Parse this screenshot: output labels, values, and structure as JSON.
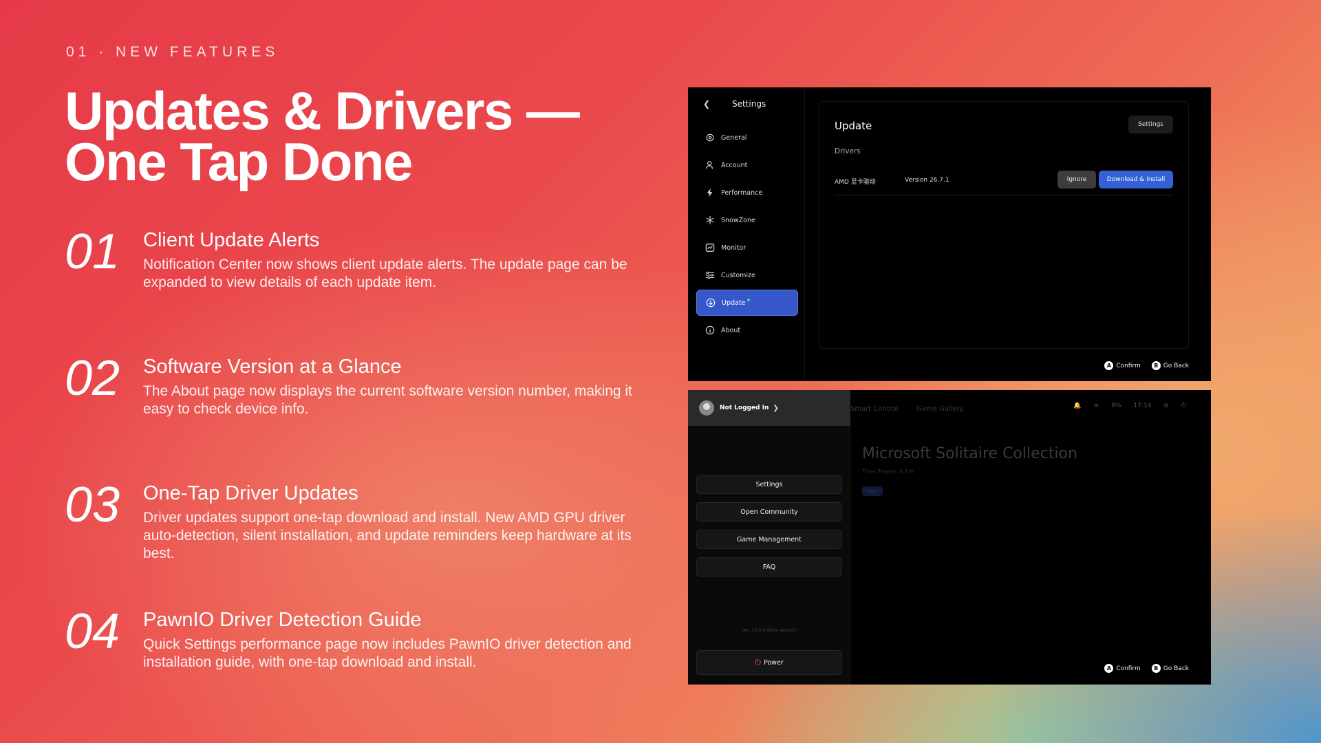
{
  "eyebrow": "01 · NEW FEATURES",
  "title_line1": "Updates & Drivers —",
  "title_line2": "One Tap Done",
  "features": [
    {
      "num": "01",
      "title": "Client Update Alerts",
      "desc": "Notification Center now shows client update alerts. The update page can be expanded to view details of each update item."
    },
    {
      "num": "02",
      "title": "Software Version at a Glance",
      "desc": "The About page now displays the current software version number, making it easy to check device info."
    },
    {
      "num": "03",
      "title": "One-Tap Driver Updates",
      "desc": "Driver updates support one-tap download and install. New AMD GPU driver auto-detection, silent installation, and update reminders keep hardware at its best."
    },
    {
      "num": "04",
      "title": "PawnIO Driver Detection Guide",
      "desc": "Quick Settings performance page now includes PawnIO driver detection and installation guide, with one-tap download and install."
    }
  ],
  "settings_screen": {
    "header": "Settings",
    "nav": [
      {
        "label": "General",
        "icon": "gear-icon"
      },
      {
        "label": "Account",
        "icon": "user-icon"
      },
      {
        "label": "Performance",
        "icon": "lightning-icon"
      },
      {
        "label": "SnowZone",
        "icon": "snowflake-icon"
      },
      {
        "label": "Monitor",
        "icon": "chart-icon"
      },
      {
        "label": "Customize",
        "icon": "sliders-icon"
      },
      {
        "label": "Update",
        "icon": "download-icon",
        "active": true
      },
      {
        "label": "About",
        "icon": "info-icon"
      }
    ],
    "panel_title": "Update",
    "settings_button": "Settings",
    "section": "Drivers",
    "driver_name": "AMD 显卡驱动",
    "driver_version": "Version 26.7.1",
    "ignore_label": "Ignore",
    "download_label": "Download & Install",
    "confirm_key": "A",
    "confirm_label": "Confirm",
    "back_key": "B",
    "back_label": "Go Back"
  },
  "menu_screen": {
    "user_label": "Not Logged In",
    "buttons": [
      "Settings",
      "Open Community",
      "Game Management",
      "FAQ"
    ],
    "version": "Ver. 3.2.0.0 (Beta Version)",
    "power_label": "Power",
    "tabs": [
      "Smart Control",
      "Game Gallery"
    ],
    "battery": "9%",
    "time": "17:14",
    "game_title": "Microsoft Solitaire Collection",
    "time_played": "Time Played: 0.3 H",
    "tag": "xbox",
    "confirm_key": "A",
    "confirm_label": "Confirm",
    "back_key": "B",
    "back_label": "Go Back"
  }
}
